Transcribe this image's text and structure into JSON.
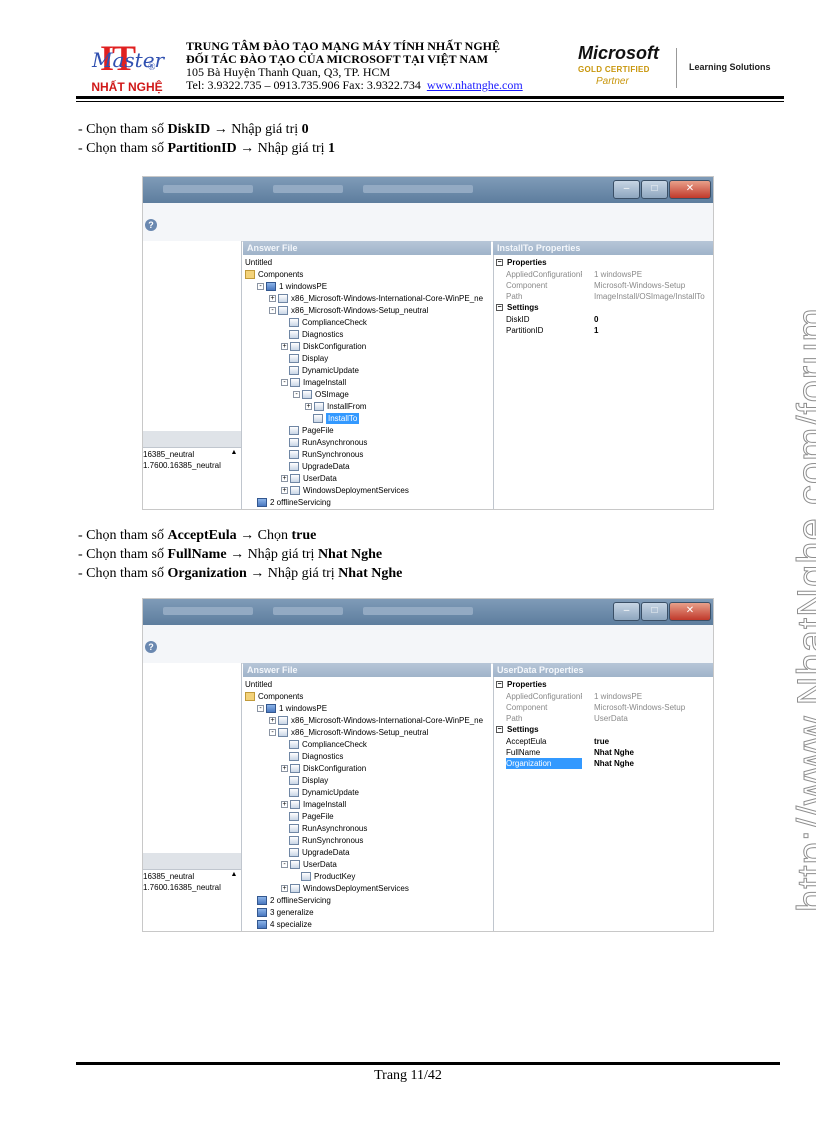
{
  "header": {
    "logo": {
      "mark": "IT",
      "script": "Master",
      "reg": "®",
      "name": "NHẤT NGHỆ"
    },
    "org_line1": "TRUNG TÂM ĐÀO TẠO MẠNG MÁY TÍNH NHẤT NGHỆ",
    "org_line2": "ĐỐI TÁC ĐÀO TẠO CỦA MICROSOFT TẠI VIỆT NAM",
    "address": "105 Bà Huyện Thanh Quan, Q3, TP. HCM",
    "phone": "Tel: 3.9322.735 – 0913.735.906 Fax: 3.9322.734",
    "website": "www.nhatnghe.com",
    "ms_logo": "Microsoft",
    "ms_gold": "GOLD CERTIFIED",
    "ms_partner": "Partner",
    "learning": "Learning Solutions"
  },
  "instructions_1": [
    {
      "prefix": "- Chọn tham số ",
      "param": "DiskID",
      "arrow": " → ",
      "action": "Nhập giá trị ",
      "value": "0"
    },
    {
      "prefix": "- Chọn tham số ",
      "param": "PartitionID",
      "arrow": " → ",
      "action": "Nhập giá trị ",
      "value": "1"
    }
  ],
  "instructions_2": [
    {
      "prefix": "- Chọn tham số ",
      "param": "AcceptEula",
      "arrow": " → ",
      "action": "Chọn ",
      "value": "true"
    },
    {
      "prefix": "- Chọn tham số ",
      "param": "FullName",
      "arrow": " → ",
      "action": "Nhập giá trị ",
      "value": "Nhat Nghe"
    },
    {
      "prefix": "- Chọn tham số ",
      "param": "Organization",
      "arrow": " → ",
      "action": "Nhập giá trị ",
      "value": "Nhat Nghe"
    }
  ],
  "shot1": {
    "left_items": [
      "16385_neutral",
      "1.7600.16385_neutral"
    ],
    "pane_answer": "Answer File",
    "pane_props": "InstallTo Properties",
    "tree": [
      "Untitled",
      "Components",
      "1 windowsPE",
      "x86_Microsoft-Windows-International-Core-WinPE_ne",
      "x86_Microsoft-Windows-Setup_neutral",
      "ComplianceCheck",
      "Diagnostics",
      "DiskConfiguration",
      "Display",
      "DynamicUpdate",
      "ImageInstall",
      "OSImage",
      "InstallFrom",
      "InstallTo",
      "PageFile",
      "RunAsynchronous",
      "RunSynchronous",
      "UpgradeData",
      "UserData",
      "WindowsDeploymentServices",
      "2 offlineServicing"
    ],
    "group_props": "Properties",
    "group_settings": "Settings",
    "readonly": [
      [
        "AppliedConfigurationPas",
        "1 windowsPE"
      ],
      [
        "Component",
        "Microsoft-Windows-Setup"
      ],
      [
        "Path",
        "ImageInstall/OSImage/InstallTo"
      ]
    ],
    "settings": [
      [
        "DiskID",
        "0"
      ],
      [
        "PartitionID",
        "1"
      ]
    ]
  },
  "shot2": {
    "left_items": [
      "16385_neutral",
      "1.7600.16385_neutral"
    ],
    "pane_answer": "Answer File",
    "pane_props": "UserData Properties",
    "tree": [
      "Untitled",
      "Components",
      "1 windowsPE",
      "x86_Microsoft-Windows-International-Core-WinPE_ne",
      "x86_Microsoft-Windows-Setup_neutral",
      "ComplianceCheck",
      "Diagnostics",
      "DiskConfiguration",
      "Display",
      "DynamicUpdate",
      "ImageInstall",
      "PageFile",
      "RunAsynchronous",
      "RunSynchronous",
      "UpgradeData",
      "UserData",
      "ProductKey",
      "WindowsDeploymentServices",
      "2 offlineServicing",
      "3 generalize",
      "4 specialize"
    ],
    "group_props": "Properties",
    "group_settings": "Settings",
    "readonly": [
      [
        "AppliedConfigurationPas",
        "1 windowsPE"
      ],
      [
        "Component",
        "Microsoft-Windows-Setup"
      ],
      [
        "Path",
        "UserData"
      ]
    ],
    "settings": [
      [
        "AcceptEula",
        "true"
      ],
      [
        "FullName",
        "Nhat Nghe"
      ],
      [
        "Organization",
        "Nhat Nghe"
      ]
    ]
  },
  "watermark": "http://www.NhatNghe.com/forum",
  "footer": {
    "page": "Trang 11/42"
  }
}
